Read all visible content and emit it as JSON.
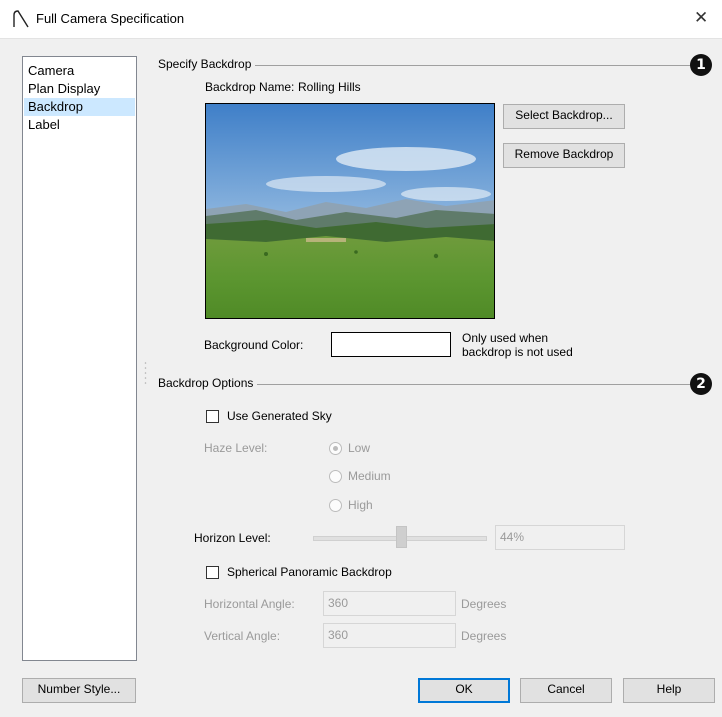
{
  "window": {
    "title": "Full Camera Specification",
    "close_glyph": "✕"
  },
  "sidebar": {
    "items": [
      {
        "label": "Camera"
      },
      {
        "label": "Plan Display"
      },
      {
        "label": "Backdrop"
      },
      {
        "label": "Label"
      }
    ],
    "selected": "Backdrop"
  },
  "specify_backdrop": {
    "group_title": "Specify Backdrop",
    "badge": "1",
    "name_label": "Backdrop Name:",
    "name_value": "Rolling Hills",
    "select_button": "Select Backdrop...",
    "remove_button": "Remove Backdrop",
    "bg_color_label": "Background Color:",
    "bg_color_value": "#ffffff",
    "note_line1": "Only used when",
    "note_line2": "backdrop is not used"
  },
  "backdrop_options": {
    "group_title": "Backdrop Options",
    "badge": "2",
    "use_generated_sky": {
      "label": "Use Generated Sky",
      "checked": false
    },
    "haze": {
      "label": "Haze Level:",
      "options": [
        "Low",
        "Medium",
        "High"
      ],
      "selected": "Low"
    },
    "horizon": {
      "label": "Horizon Level:",
      "value": "44%",
      "level": 0.44
    },
    "spherical": {
      "label": "Spherical Panoramic Backdrop",
      "checked": false
    },
    "horizontal_angle": {
      "label": "Horizontal Angle:",
      "value": "360",
      "unit": "Degrees"
    },
    "vertical_angle": {
      "label": "Vertical Angle:",
      "value": "360",
      "unit": "Degrees"
    }
  },
  "footer": {
    "number_style": "Number Style...",
    "ok": "OK",
    "cancel": "Cancel",
    "help": "Help"
  },
  "colors": {
    "selection": "#cce8ff",
    "default_button_border": "#0078d7"
  }
}
